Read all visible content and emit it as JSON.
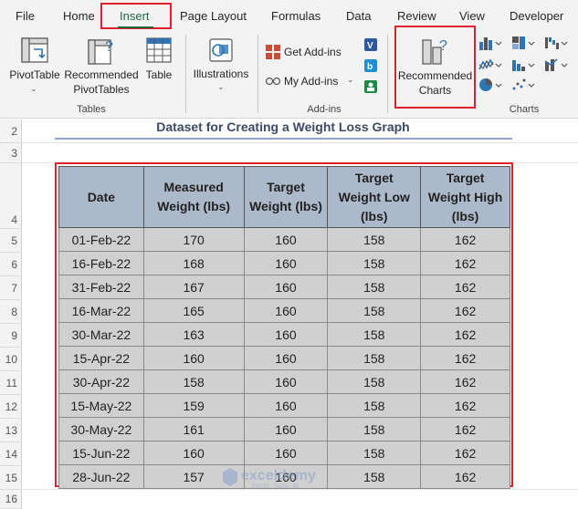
{
  "ribbon": {
    "tabs": [
      "File",
      "Home",
      "Insert",
      "Page Layout",
      "Formulas",
      "Data",
      "Review",
      "View",
      "Developer"
    ],
    "active_tab": "Insert",
    "buttons": {
      "pivot_table": "PivotTable",
      "recommended_pivot_line1": "Recommended",
      "recommended_pivot_line2": "PivotTables",
      "table": "Table",
      "illustrations": "Illustrations",
      "get_addins": "Get Add-ins",
      "my_addins": "My Add-ins",
      "recommended_charts_line1": "Recommended",
      "recommended_charts_line2": "Charts"
    },
    "groups": {
      "tables": "Tables",
      "addins": "Add-ins",
      "charts": "Charts"
    },
    "highlight_color": "#e0202e",
    "accent_color": "#1d6a3e"
  },
  "sheet": {
    "row_numbers": [
      "2",
      "3",
      "4",
      "5",
      "6",
      "7",
      "8",
      "9",
      "10",
      "11",
      "12",
      "13",
      "14",
      "15",
      "16"
    ],
    "title": "Dataset for Creating a Weight Loss Graph",
    "headers": {
      "date": "Date",
      "measured_1": "Measured",
      "measured_2": "Weight (lbs)",
      "target_1": "Target",
      "target_2": "Weight (lbs)",
      "low_1": "Target",
      "low_2": "Weight Low",
      "low_3": "(lbs)",
      "high_1": "Target",
      "high_2": "Weight High",
      "high_3": "(lbs)"
    },
    "rows": [
      [
        "01-Feb-22",
        "170",
        "160",
        "158",
        "162"
      ],
      [
        "16-Feb-22",
        "168",
        "160",
        "158",
        "162"
      ],
      [
        "31-Feb-22",
        "167",
        "160",
        "158",
        "162"
      ],
      [
        "16-Mar-22",
        "165",
        "160",
        "158",
        "162"
      ],
      [
        "30-Mar-22",
        "163",
        "160",
        "158",
        "162"
      ],
      [
        "15-Apr-22",
        "160",
        "160",
        "158",
        "162"
      ],
      [
        "30-Apr-22",
        "158",
        "160",
        "158",
        "162"
      ],
      [
        "15-May-22",
        "159",
        "160",
        "158",
        "162"
      ],
      [
        "30-May-22",
        "161",
        "160",
        "158",
        "162"
      ],
      [
        "15-Jun-22",
        "160",
        "160",
        "158",
        "162"
      ],
      [
        "28-Jun-22",
        "157",
        "160",
        "158",
        "162"
      ]
    ],
    "header_color": "#acb9ca",
    "cell_color": "#d0d0d0"
  },
  "watermark": {
    "brand": "exceldemy",
    "tagline": "EXCEL · DATA · BI"
  }
}
